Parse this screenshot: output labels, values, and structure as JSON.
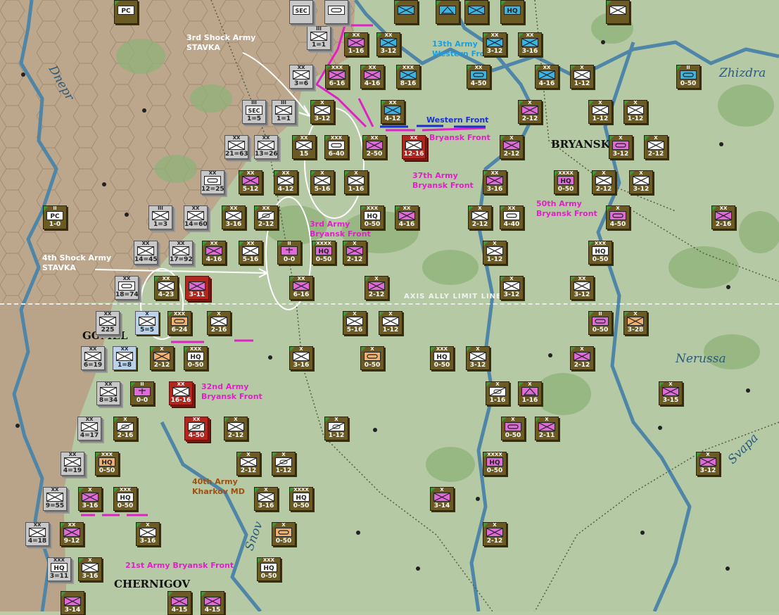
{
  "map": {
    "limit_label": "AXIS ALLY LIMIT LINE",
    "cities": [
      "BRYANSK",
      "GOMEL",
      "CHERNIGOV"
    ],
    "rivers": [
      "Dnepr",
      "Zhizdra",
      "Nerussa",
      "Snov",
      "Svapa"
    ]
  },
  "annotations": [
    {
      "lines": [
        "3rd Shock Army",
        "STAVKA"
      ],
      "color": "#ffffff"
    },
    {
      "lines": [
        "13th Army",
        "Western Front"
      ],
      "color": "#1aa0e0"
    },
    {
      "lines": [
        "Western Front"
      ],
      "color": "#1a2fd0"
    },
    {
      "lines": [
        "Bryansk Front"
      ],
      "color": "#e020c8"
    },
    {
      "lines": [
        "37th Army",
        "Bryansk Front"
      ],
      "color": "#e020c8"
    },
    {
      "lines": [
        "50th Army",
        "Bryansk Front"
      ],
      "color": "#e020c8"
    },
    {
      "lines": [
        "3rd Army",
        "Bryansk Front"
      ],
      "color": "#e020c8"
    },
    {
      "lines": [
        "4th Shock Army",
        "STAVKA"
      ],
      "color": "#ffffff"
    },
    {
      "lines": [
        "32nd Army",
        "Bryansk Front"
      ],
      "color": "#e020c8"
    },
    {
      "lines": [
        "40th Army",
        "Kharkov MD"
      ],
      "color": "#a05010"
    },
    {
      "lines": [
        "21st Army Bryansk Front"
      ],
      "color": "#e020c8"
    }
  ],
  "units": [
    {
      "str": "1-16",
      "size": "XX",
      "type": "inf",
      "fill": "#e06ad8",
      "style": "soviet"
    },
    {
      "str": "3-12",
      "size": "XX",
      "type": "inf",
      "fill": "#3ab4e0",
      "style": "soviet"
    },
    {
      "str": "3-12",
      "size": "XX",
      "type": "inf",
      "fill": "#3ab4e0",
      "style": "soviet"
    },
    {
      "str": "3-16",
      "size": "XX",
      "type": "inf",
      "fill": "#3ab4e0",
      "style": "soviet"
    },
    {
      "str": "6-16",
      "size": "XXX",
      "type": "inf",
      "fill": "#e06ad8",
      "style": "soviet"
    },
    {
      "str": "4-16",
      "size": "XX",
      "type": "inf",
      "fill": "#e06ad8",
      "style": "soviet"
    },
    {
      "str": "8-16",
      "size": "XXX",
      "type": "inf",
      "fill": "#3ab4e0",
      "style": "soviet"
    },
    {
      "str": "4-50",
      "size": "XX",
      "type": "armor",
      "fill": "#3ab4e0",
      "style": "soviet"
    },
    {
      "str": "4-16",
      "size": "XX",
      "type": "inf",
      "fill": "#3ab4e0",
      "style": "soviet"
    },
    {
      "str": "1-12",
      "size": "X",
      "type": "inf",
      "fill": "#ffffff",
      "style": "soviet"
    },
    {
      "str": "0-50",
      "size": "II",
      "type": "armor",
      "fill": "#3ab4e0",
      "style": "soviet"
    },
    {
      "str": "3-12",
      "size": "X",
      "type": "inf",
      "fill": "#ffffff",
      "style": "soviet"
    },
    {
      "str": "4-12",
      "size": "XX",
      "type": "inf",
      "fill": "#3ab4e0",
      "style": "soviet"
    },
    {
      "str": "2-12",
      "size": "X",
      "type": "inf",
      "fill": "#e06ad8",
      "style": "soviet"
    },
    {
      "str": "1-12",
      "size": "X",
      "type": "inf",
      "fill": "#ffffff",
      "style": "soviet"
    },
    {
      "str": "1-12",
      "size": "X",
      "type": "inf",
      "fill": "#ffffff",
      "style": "soviet"
    },
    {
      "str": "2-50",
      "size": "XX",
      "type": "inf",
      "fill": "#e06ad8",
      "style": "soviet"
    },
    {
      "str": "12-16",
      "size": "XX",
      "type": "inf",
      "fill": "#ffffff",
      "style": "red"
    },
    {
      "str": "2-12",
      "size": "X",
      "type": "inf",
      "fill": "#e06ad8",
      "style": "soviet"
    },
    {
      "str": "3-12",
      "size": "X",
      "type": "armor",
      "fill": "#e06ad8",
      "style": "soviet"
    },
    {
      "str": "2-12",
      "size": "X",
      "type": "inf",
      "fill": "#ffffff",
      "style": "soviet"
    },
    {
      "str": "15",
      "size": "XX",
      "type": "inf",
      "fill": "#ffffff",
      "style": "soviet"
    },
    {
      "str": "6-40",
      "size": "XXX",
      "type": "armor",
      "fill": "#ffffff",
      "style": "soviet"
    },
    {
      "str": "5-12",
      "size": "XX",
      "type": "inf",
      "fill": "#e06ad8",
      "style": "soviet"
    },
    {
      "str": "4-12",
      "size": "XX",
      "type": "inf",
      "fill": "#ffffff",
      "style": "soviet"
    },
    {
      "str": "5-16",
      "size": "X",
      "type": "inf",
      "fill": "#ffffff",
      "style": "soviet"
    },
    {
      "str": "1-16",
      "size": "X",
      "type": "inf",
      "fill": "#ffffff",
      "style": "soviet"
    },
    {
      "str": "3-16",
      "size": "XX",
      "type": "inf",
      "fill": "#e06ad8",
      "style": "soviet"
    },
    {
      "str": "0-50",
      "size": "XXXX",
      "type": "hq",
      "fill": "#e06ad8",
      "style": "soviet"
    },
    {
      "str": "2-12",
      "size": "X",
      "type": "inf",
      "fill": "#ffffff",
      "style": "soviet"
    },
    {
      "str": "3-12",
      "size": "X",
      "type": "inf",
      "fill": "#ffffff",
      "style": "soviet"
    },
    {
      "str": "2-12",
      "size": "XX",
      "type": "cav",
      "fill": "#ffffff",
      "style": "soviet"
    },
    {
      "str": "3-16",
      "size": "XX",
      "type": "inf",
      "fill": "#ffffff",
      "style": "soviet"
    },
    {
      "str": "4-40",
      "size": "XX",
      "type": "armor",
      "fill": "#ffffff",
      "style": "soviet"
    },
    {
      "str": "0-50",
      "size": "XXX",
      "type": "hq",
      "fill": "#ffffff",
      "style": "soviet"
    },
    {
      "str": "4-16",
      "size": "XX",
      "type": "inf",
      "fill": "#e06ad8",
      "style": "soviet"
    },
    {
      "str": "2-12",
      "size": "X",
      "type": "inf",
      "fill": "#ffffff",
      "style": "soviet"
    },
    {
      "str": "4-50",
      "size": "X",
      "type": "armor",
      "fill": "#e06ad8",
      "style": "soviet"
    },
    {
      "str": "2-16",
      "size": "XX",
      "type": "inf",
      "fill": "#e06ad8",
      "style": "soviet"
    },
    {
      "str": "4-16",
      "size": "XX",
      "type": "inf",
      "fill": "#e06ad8",
      "style": "soviet"
    },
    {
      "str": "5-16",
      "size": "XX",
      "type": "inf",
      "fill": "#ffffff",
      "style": "soviet"
    },
    {
      "str": "0-0",
      "size": "II",
      "type": "eng",
      "fill": "#e06ad8",
      "style": "soviet"
    },
    {
      "str": "0-50",
      "size": "XXXX",
      "type": "hq",
      "fill": "#e06ad8",
      "style": "soviet"
    },
    {
      "str": "2-12",
      "size": "X",
      "type": "inf",
      "fill": "#e06ad8",
      "style": "soviet"
    },
    {
      "str": "1-12",
      "size": "X",
      "type": "inf",
      "fill": "#ffffff",
      "style": "soviet"
    },
    {
      "str": "0-50",
      "size": "XXX",
      "type": "hq",
      "fill": "#ffffff",
      "style": "soviet"
    },
    {
      "str": "6-16",
      "size": "XX",
      "type": "inf",
      "fill": "#e06ad8",
      "style": "soviet"
    },
    {
      "str": "2-12",
      "size": "X",
      "type": "inf",
      "fill": "#e06ad8",
      "style": "soviet"
    },
    {
      "str": "3-12",
      "size": "X",
      "type": "inf",
      "fill": "#ffffff",
      "style": "soviet"
    },
    {
      "str": "3-12",
      "size": "XX",
      "type": "inf",
      "fill": "#ffffff",
      "style": "soviet"
    },
    {
      "str": "4-23",
      "size": "XX",
      "type": "inf",
      "fill": "#ffffff",
      "style": "soviet"
    },
    {
      "str": "6-24",
      "size": "XXX",
      "type": "armor",
      "fill": "#f0b070",
      "style": "soviet"
    },
    {
      "str": "2-16",
      "size": "X",
      "type": "inf",
      "fill": "#ffffff",
      "style": "soviet"
    },
    {
      "str": "5-16",
      "size": "X",
      "type": "inf",
      "fill": "#ffffff",
      "style": "soviet"
    },
    {
      "str": "1-12",
      "size": "X",
      "type": "inf",
      "fill": "#ffffff",
      "style": "soviet"
    },
    {
      "str": "0-50",
      "size": "II",
      "type": "armor",
      "fill": "#e06ad8",
      "style": "soviet"
    },
    {
      "str": "3-28",
      "size": "X",
      "type": "inf",
      "fill": "#f0b070",
      "style": "soviet"
    },
    {
      "str": "2-12",
      "size": "X",
      "type": "inf",
      "fill": "#f0b070",
      "style": "soviet"
    },
    {
      "str": "0-50",
      "size": "XXX",
      "type": "hq",
      "fill": "#ffffff",
      "style": "soviet"
    },
    {
      "str": "3-16",
      "size": "X",
      "type": "inf",
      "fill": "#ffffff",
      "style": "soviet"
    },
    {
      "str": "0-50",
      "size": "X",
      "type": "armor",
      "fill": "#f0b070",
      "style": "soviet"
    },
    {
      "str": "0-50",
      "size": "XXX",
      "type": "hq",
      "fill": "#ffffff",
      "style": "soviet"
    },
    {
      "str": "3-12",
      "size": "X",
      "type": "inf",
      "fill": "#ffffff",
      "style": "soviet"
    },
    {
      "str": "2-12",
      "size": "X",
      "type": "inf",
      "fill": "#e06ad8",
      "style": "soviet"
    },
    {
      "str": "0-0",
      "size": "II",
      "type": "eng",
      "fill": "#e06ad8",
      "style": "soviet"
    },
    {
      "str": "16-16",
      "size": "XX",
      "type": "inf",
      "fill": "#ffffff",
      "style": "red"
    },
    {
      "str": "1-16",
      "size": "X",
      "type": "cav",
      "fill": "#ffffff",
      "style": "soviet"
    },
    {
      "str": "1-16",
      "size": "X",
      "type": "art",
      "fill": "#e06ad8",
      "style": "soviet"
    },
    {
      "str": "3-15",
      "size": "X",
      "type": "inf",
      "fill": "#e06ad8",
      "style": "soviet"
    },
    {
      "str": "2-16",
      "size": "X",
      "type": "cav",
      "fill": "#ffffff",
      "style": "soviet"
    },
    {
      "str": "4-50",
      "size": "XX",
      "type": "cav",
      "fill": "#ffffff",
      "style": "red"
    },
    {
      "str": "2-12",
      "size": "X",
      "type": "inf",
      "fill": "#ffffff",
      "style": "soviet"
    },
    {
      "str": "1-12",
      "size": "X",
      "type": "cav",
      "fill": "#ffffff",
      "style": "soviet"
    },
    {
      "str": "0-50",
      "size": "X",
      "type": "armor",
      "fill": "#e06ad8",
      "style": "soviet"
    },
    {
      "str": "2-11",
      "size": "X",
      "type": "inf",
      "fill": "#e06ad8",
      "style": "soviet"
    },
    {
      "str": "0-50",
      "size": "XXX",
      "type": "hq",
      "fill": "#f0b070",
      "style": "soviet"
    },
    {
      "str": "2-12",
      "size": "X",
      "type": "inf",
      "fill": "#ffffff",
      "style": "soviet"
    },
    {
      "str": "1-12",
      "size": "X",
      "type": "cav",
      "fill": "#ffffff",
      "style": "soviet"
    },
    {
      "str": "0-50",
      "size": "XXXX",
      "type": "hq",
      "fill": "#e06ad8",
      "style": "soviet"
    },
    {
      "str": "3-12",
      "size": "X",
      "type": "inf",
      "fill": "#e06ad8",
      "style": "soviet"
    },
    {
      "str": "3-16",
      "size": "X",
      "type": "inf",
      "fill": "#e06ad8",
      "style": "soviet"
    },
    {
      "str": "0-50",
      "size": "XXX",
      "type": "hq",
      "fill": "#ffffff",
      "style": "soviet"
    },
    {
      "str": "3-16",
      "size": "X",
      "type": "inf",
      "fill": "#ffffff",
      "style": "soviet"
    },
    {
      "str": "0-50",
      "size": "XXXX",
      "type": "hq",
      "fill": "#ffffff",
      "style": "soviet"
    },
    {
      "str": "3-14",
      "size": "X",
      "type": "inf",
      "fill": "#e06ad8",
      "style": "soviet"
    },
    {
      "str": "9-12",
      "size": "XX",
      "type": "inf",
      "fill": "#e06ad8",
      "style": "soviet"
    },
    {
      "str": "3-16",
      "size": "X",
      "type": "inf",
      "fill": "#ffffff",
      "style": "soviet"
    },
    {
      "str": "0-50",
      "size": "X",
      "type": "armor",
      "fill": "#f0b070",
      "style": "soviet"
    },
    {
      "str": "2-12",
      "size": "X",
      "type": "inf",
      "fill": "#e06ad8",
      "style": "soviet"
    },
    {
      "str": "3-16",
      "size": "X",
      "type": "inf",
      "fill": "#ffffff",
      "style": "soviet"
    },
    {
      "str": "0-50",
      "size": "XXX",
      "type": "hq",
      "fill": "#ffffff",
      "style": "soviet"
    },
    {
      "str": "1=1",
      "size": "III",
      "type": "inf",
      "fill": "#ffffff",
      "style": "axis"
    },
    {
      "str": "3=6",
      "size": "XX",
      "type": "inf",
      "fill": "#ffffff",
      "style": "axis"
    },
    {
      "str": "1=5",
      "size": "III",
      "type": "sec",
      "fill": "#ffffff",
      "style": "axis"
    },
    {
      "str": "1=1",
      "size": "III",
      "type": "inf",
      "fill": "#ffffff",
      "style": "axis"
    },
    {
      "str": "21=63",
      "size": "XX",
      "type": "inf",
      "fill": "#ffffff",
      "style": "axis"
    },
    {
      "str": "13=26",
      "size": "XX",
      "type": "inf",
      "fill": "#ffffff",
      "style": "axis"
    },
    {
      "str": "12=25",
      "size": "XX",
      "type": "armor",
      "fill": "#ffffff",
      "style": "axis"
    },
    {
      "str": "1=3",
      "size": "III",
      "type": "inf",
      "fill": "#ffffff",
      "style": "axis"
    },
    {
      "str": "14=60",
      "size": "XX",
      "type": "inf",
      "fill": "#ffffff",
      "style": "axis"
    },
    {
      "str": "14=45",
      "size": "XX",
      "type": "inf",
      "fill": "#ffffff",
      "style": "axis"
    },
    {
      "str": "17=92",
      "size": "XX",
      "type": "inf",
      "fill": "#ffffff",
      "style": "axis"
    },
    {
      "str": "18=74",
      "size": "XX",
      "type": "armor",
      "fill": "#ffffff",
      "style": "axis"
    },
    {
      "str": "225",
      "size": "XX",
      "type": "inf",
      "fill": "#ffffff",
      "style": "axis"
    },
    {
      "str": "5=5",
      "size": "X",
      "type": "inf",
      "fill": "#ffffff",
      "style": "lightblue"
    },
    {
      "str": "6=19",
      "size": "XX",
      "type": "inf",
      "fill": "#ffffff",
      "style": "axis"
    },
    {
      "str": "1=8",
      "size": "XX",
      "type": "inf",
      "fill": "#ffffff",
      "style": "lightblue"
    },
    {
      "str": "8=34",
      "size": "XX",
      "type": "inf",
      "fill": "#ffffff",
      "style": "axis"
    },
    {
      "str": "4=17",
      "size": "XX",
      "type": "inf",
      "fill": "#ffffff",
      "style": "axis"
    },
    {
      "str": "4=19",
      "size": "XX",
      "type": "inf",
      "fill": "#ffffff",
      "style": "axis"
    },
    {
      "str": "9=55",
      "size": "XX",
      "type": "inf",
      "fill": "#ffffff",
      "style": "axis"
    },
    {
      "str": "4=18",
      "size": "XX",
      "type": "inf",
      "fill": "#ffffff",
      "style": "axis"
    },
    {
      "str": "3=11",
      "size": "XXX",
      "type": "hq",
      "fill": "#ffffff",
      "style": "axis"
    },
    {
      "str": "1-0",
      "size": "II",
      "type": "pc",
      "fill": "#ffffff",
      "style": "soviet"
    },
    {
      "str": "",
      "size": "",
      "type": "pc",
      "fill": "#ffffff",
      "style": "soviet"
    },
    {
      "str": "",
      "size": "",
      "type": "sec",
      "fill": "#ffffff",
      "style": "axis"
    },
    {
      "str": "",
      "size": "",
      "type": "armor",
      "fill": "#ffffff",
      "style": "axis"
    },
    {
      "str": "",
      "size": "",
      "type": "inf",
      "fill": "#3ab4e0",
      "style": "soviet"
    },
    {
      "str": "",
      "size": "",
      "type": "mtn",
      "fill": "#3ab4e0",
      "style": "soviet"
    },
    {
      "str": "",
      "size": "",
      "type": "inf",
      "fill": "#3ab4e0",
      "style": "soviet"
    },
    {
      "str": "",
      "size": "",
      "type": "hq",
      "fill": "#3ab4e0",
      "style": "soviet"
    },
    {
      "str": "",
      "size": "",
      "type": "inf",
      "fill": "#ffffff",
      "style": "soviet"
    },
    {
      "str": "3-11",
      "size": "",
      "type": "inf",
      "fill": "#e06ad8",
      "style": "red"
    },
    {
      "str": "3-14",
      "size": "",
      "type": "inf",
      "fill": "#e06ad8",
      "style": "soviet"
    },
    {
      "str": "4-15",
      "size": "",
      "type": "inf",
      "fill": "#e06ad8",
      "style": "soviet"
    },
    {
      "str": "4-15",
      "size": "",
      "type": "inf",
      "fill": "#e06ad8",
      "style": "soviet"
    }
  ]
}
